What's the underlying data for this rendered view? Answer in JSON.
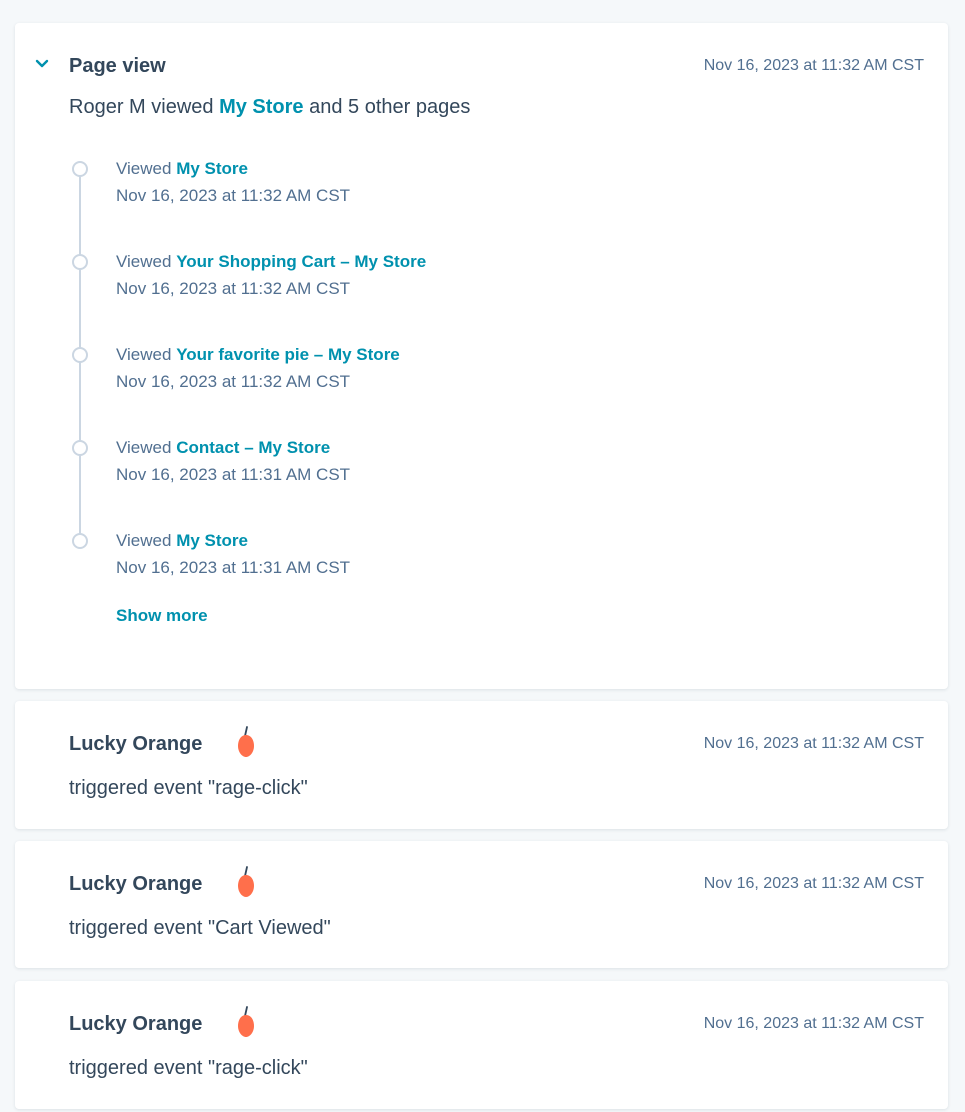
{
  "page_view": {
    "title": "Page view",
    "timestamp": "Nov 16, 2023 at 11:32 AM CST",
    "summary_prefix": "Roger M viewed ",
    "summary_link": "My Store",
    "summary_suffix": " and 5 other pages",
    "viewed_prefix": "Viewed ",
    "items": [
      {
        "page": "My Store",
        "time": "Nov 16, 2023 at 11:32 AM CST"
      },
      {
        "page": "Your Shopping Cart – My Store",
        "time": "Nov 16, 2023 at 11:32 AM CST"
      },
      {
        "page": "Your favorite pie – My Store",
        "time": "Nov 16, 2023 at 11:32 AM CST"
      },
      {
        "page": "Contact – My Store",
        "time": "Nov 16, 2023 at 11:31 AM CST"
      },
      {
        "page": "My Store",
        "time": "Nov 16, 2023 at 11:31 AM CST"
      }
    ],
    "show_more": "Show more"
  },
  "events": [
    {
      "source": "Lucky Orange",
      "timestamp": "Nov 16, 2023 at 11:32 AM CST",
      "description": "triggered event \"rage-click\""
    },
    {
      "source": "Lucky Orange",
      "timestamp": "Nov 16, 2023 at 11:32 AM CST",
      "description": "triggered event \"Cart Viewed\""
    },
    {
      "source": "Lucky Orange",
      "timestamp": "Nov 16, 2023 at 11:32 AM CST",
      "description": "triggered event \"rage-click\""
    }
  ],
  "icons": {
    "chevron": "chevron-down-icon",
    "orange": "orange-logo-icon"
  },
  "colors": {
    "accent": "#0091ae",
    "text": "#33475b",
    "muted": "#516f90",
    "orange": "#ff6f4b",
    "timeline": "#cbd6e2"
  }
}
